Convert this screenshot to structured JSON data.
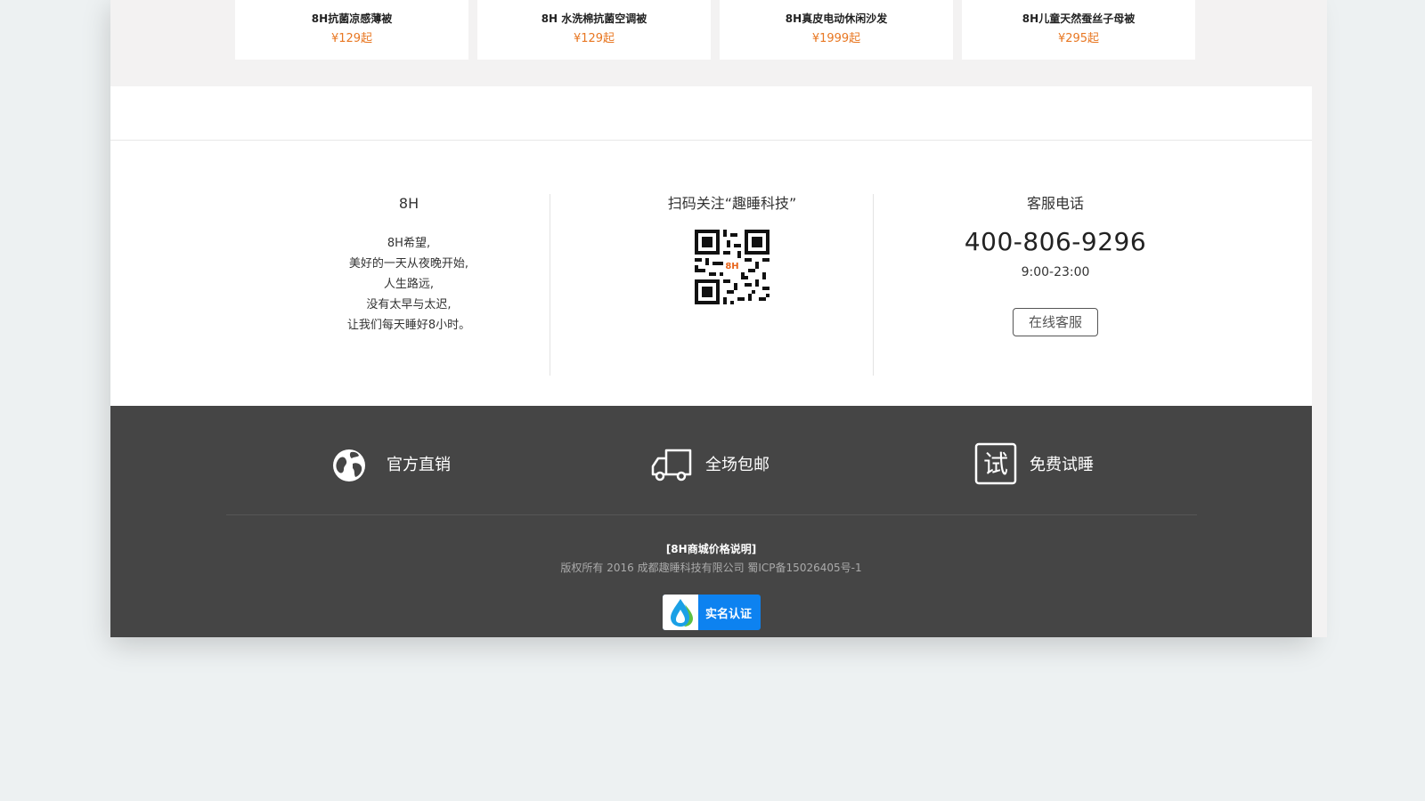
{
  "products": [
    {
      "name": "8H抗菌凉感薄被",
      "price": "¥129起"
    },
    {
      "name": "8H 水洗棉抗菌空调被",
      "price": "¥129起"
    },
    {
      "name": "8H真皮电动休闲沙发",
      "price": "¥1999起"
    },
    {
      "name": "8H儿童天然蚕丝子母被",
      "price": "¥295起"
    }
  ],
  "about": {
    "title": "8H",
    "lines": [
      "8H希望,",
      "美好的一天从夜晚开始,",
      "人生路远,",
      "没有太早与太迟,",
      "让我们每天睡好8小时。"
    ]
  },
  "qr": {
    "title": "扫码关注“趣睡科技”",
    "logo_text": "8H",
    "icon": "qr-code-icon"
  },
  "contact": {
    "title": "客服电话",
    "phone": "400-806-9296",
    "hours": "9:00-23:00",
    "button_label": "在线客服"
  },
  "features": [
    {
      "label": "官方直销",
      "icon": "globe-icon"
    },
    {
      "label": "全场包邮",
      "icon": "truck-icon"
    },
    {
      "label": "免费试睡",
      "icon": "trial-icon",
      "icon_text": "试"
    }
  ],
  "footer": {
    "price_note": "[8H商城价格说明]",
    "copyright": "版权所有 2016 成都趣睡科技有限公司 蜀ICP备15026405号-1",
    "badge_label": "实名认证"
  },
  "colors": {
    "price": "#e87722",
    "footer_bg": "#454545",
    "badge_bg": "#0d82f0",
    "page_bg": "#edf1f2"
  }
}
